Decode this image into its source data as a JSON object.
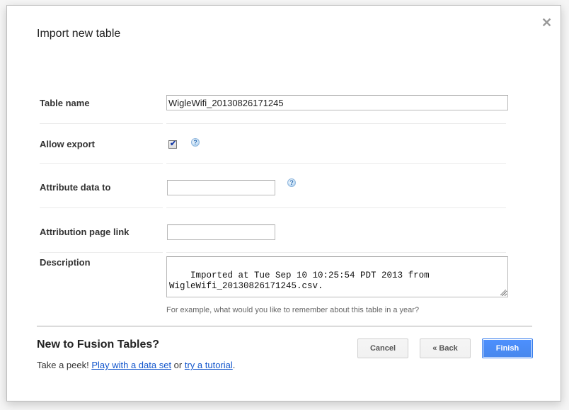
{
  "dialog": {
    "title": "Import new table",
    "close_icon": "close-icon"
  },
  "form": {
    "table_name": {
      "label": "Table name",
      "value": "WigleWifi_20130826171245"
    },
    "allow_export": {
      "label": "Allow export",
      "checked": true,
      "check_glyph": "✔",
      "help_glyph": "?"
    },
    "attribute_data_to": {
      "label": "Attribute data to",
      "value": "",
      "help_glyph": "?"
    },
    "attribution_page_link": {
      "label": "Attribution page link",
      "value": ""
    },
    "description": {
      "label": "Description",
      "value": "Imported at Tue Sep 10 10:25:54 PDT 2013 from\nWigleWifi_20130826171245.csv.",
      "hint": "For example, what would you like to remember about this table in a year?"
    }
  },
  "promo": {
    "title": "New to Fusion Tables?",
    "prefix": "Take a peek! ",
    "link1": "Play with a data set",
    "middle": " or ",
    "link2": "try a tutorial",
    "suffix": "."
  },
  "buttons": {
    "cancel": "Cancel",
    "back": "« Back",
    "finish": "Finish"
  },
  "colors": {
    "primary": "#4d90fe",
    "link": "#1155cc"
  }
}
